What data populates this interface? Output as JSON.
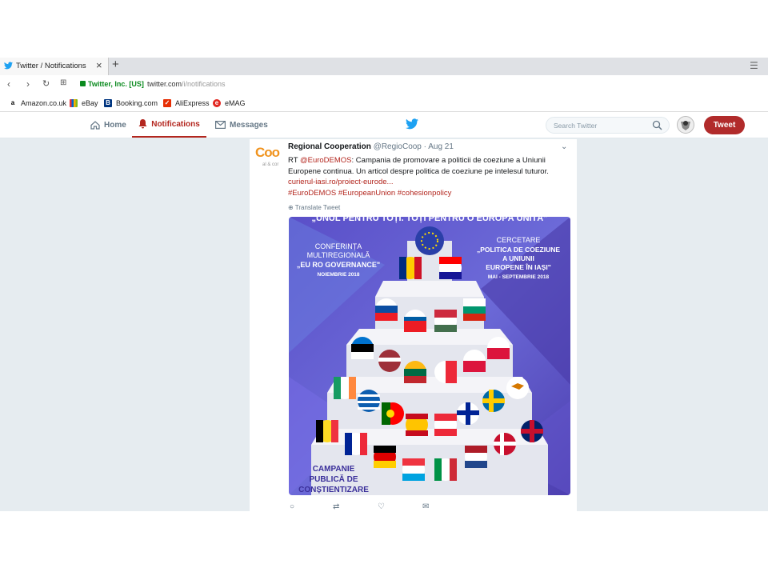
{
  "browser": {
    "tab_title": "Twitter / Notifications",
    "tab_close": "×",
    "new_tab": "+",
    "security_label": "Twitter, Inc. [US]",
    "url_host": "twitter.com",
    "url_path": "/i/notifications",
    "bookmarks": [
      {
        "label": "Amazon.co.uk",
        "icon": "amazon-icon"
      },
      {
        "label": "eBay",
        "icon": "ebay-icon"
      },
      {
        "label": "Booking.com",
        "icon": "booking-icon"
      },
      {
        "label": "AliExpress",
        "icon": "aliexpress-icon"
      },
      {
        "label": "eMAG",
        "icon": "emag-icon"
      }
    ]
  },
  "twitter": {
    "nav": {
      "home": "Home",
      "notifications": "Notifications",
      "messages": "Messages"
    },
    "search_placeholder": "Search Twitter",
    "tweet_button": "Tweet",
    "accent": "#b3261e"
  },
  "tweet": {
    "logo_text": "Coo",
    "logo_subtext": "al & cor",
    "name": "Regional Cooperation",
    "handle": "@RegioCoop",
    "date": "· Aug 21",
    "text_prefix": "RT ",
    "mention": "@EuroDEMOS",
    "text": ": Campania de promovare a politicii de coeziune a Uniunii Europene continua. Un articol despre politica de coeziune pe intelesul tuturor.",
    "link": "curierul-iasi.ro/proiect-eurode...",
    "hashtags": "#EuroDEMOS #EuropeanUnion #cohesionpolicy",
    "translate": "Translate Tweet"
  },
  "poster": {
    "top_banner": "„UNUL PENTRU TOȚI. TOȚI PENTRU O EUROPĂ UNITĂ\"",
    "left_title_1": "CONFERINȚA",
    "left_title_2": "MULTIREGIONALĂ",
    "left_title_3": "„EU RO GOVERNANCE\"",
    "left_date": "NOIEMBRIE 2018",
    "right_title_1": "CERCETARE",
    "right_title_2": "„POLITICA DE COEZIUNE",
    "right_title_3": "A UNIUNII",
    "right_title_4": "EUROPENE ÎN IAȘI\"",
    "right_date": "MAI - SEPTEMBRIE 2018",
    "bottom_1": "CAMPANIE",
    "bottom_2": "PUBLICĂ DE",
    "bottom_3": "CONȘTIENTIZARE"
  }
}
